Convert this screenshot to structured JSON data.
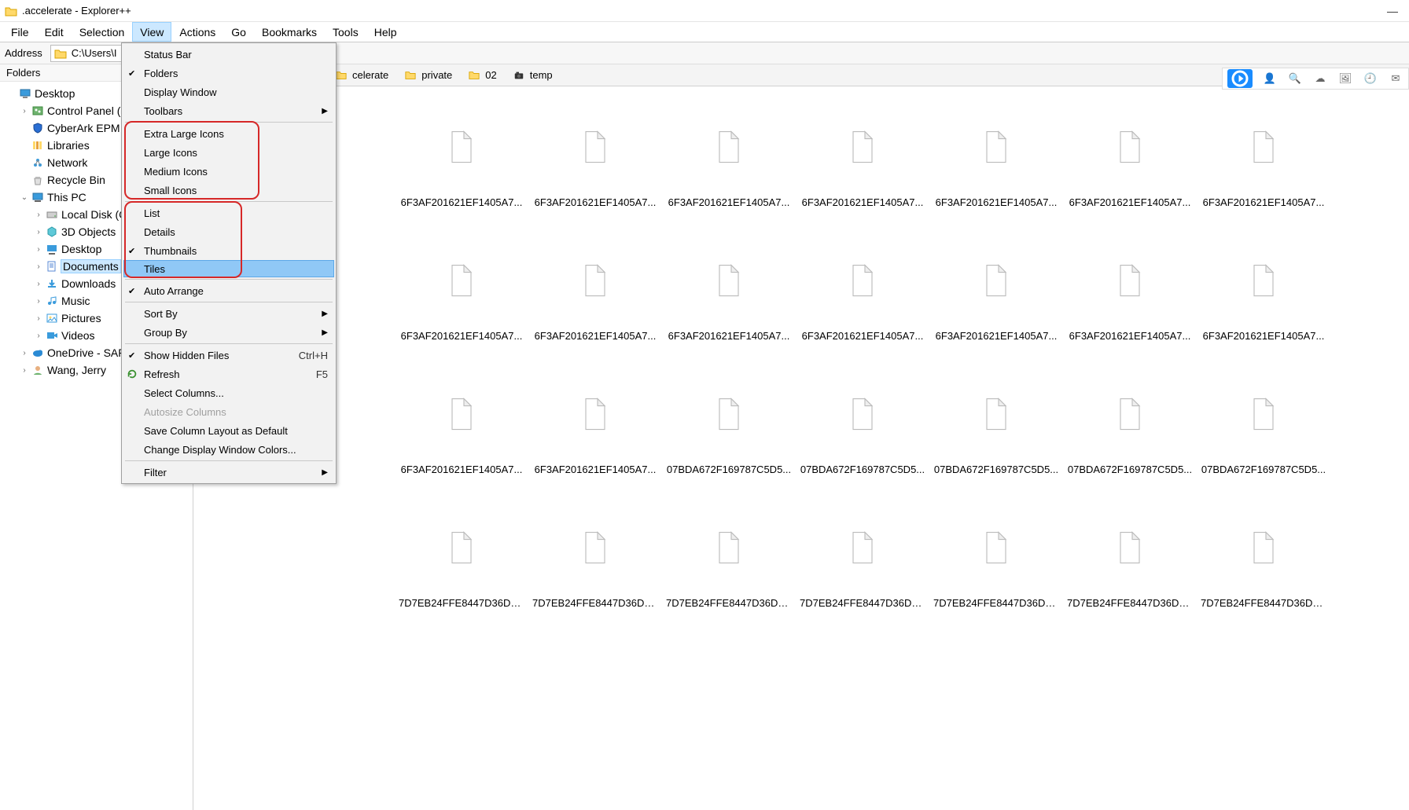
{
  "window": {
    "title": ".accelerate - Explorer++"
  },
  "menubar": {
    "items": [
      "File",
      "Edit",
      "Selection",
      "View",
      "Actions",
      "Go",
      "Bookmarks",
      "Tools",
      "Help"
    ],
    "active_index": 3
  },
  "addressbar": {
    "label": "Address",
    "path": "C:\\Users\\I"
  },
  "sidebar": {
    "header": "Folders",
    "tree": [
      {
        "label": "Desktop",
        "icon": "monitor",
        "indent": 0,
        "expandable": false
      },
      {
        "label": "Control Panel (",
        "icon": "panel",
        "indent": 1,
        "expandable": true
      },
      {
        "label": "CyberArk EPM C",
        "icon": "shield",
        "indent": 1,
        "expandable": false
      },
      {
        "label": "Libraries",
        "icon": "libraries",
        "indent": 1,
        "expandable": false
      },
      {
        "label": "Network",
        "icon": "network",
        "indent": 1,
        "expandable": false
      },
      {
        "label": "Recycle Bin",
        "icon": "recycle",
        "indent": 1,
        "expandable": false
      },
      {
        "label": "This PC",
        "icon": "pc",
        "indent": 1,
        "expandable": true,
        "expanded": true
      },
      {
        "label": "Local Disk (C",
        "icon": "disk",
        "indent": 2,
        "expandable": true
      },
      {
        "label": "3D Objects",
        "icon": "3d",
        "indent": 2,
        "expandable": true
      },
      {
        "label": "Desktop",
        "icon": "desktop",
        "indent": 2,
        "expandable": true
      },
      {
        "label": "Documents",
        "icon": "docs",
        "indent": 2,
        "expandable": true,
        "selected": true
      },
      {
        "label": "Downloads",
        "icon": "downloads",
        "indent": 2,
        "expandable": true
      },
      {
        "label": "Music",
        "icon": "music",
        "indent": 2,
        "expandable": true
      },
      {
        "label": "Pictures",
        "icon": "pictures",
        "indent": 2,
        "expandable": true
      },
      {
        "label": "Videos",
        "icon": "videos",
        "indent": 2,
        "expandable": true
      },
      {
        "label": "OneDrive - SAP",
        "icon": "onedrive",
        "indent": 1,
        "expandable": true
      },
      {
        "label": "Wang, Jerry",
        "icon": "user",
        "indent": 1,
        "expandable": true
      }
    ]
  },
  "tabs": [
    {
      "label": "celerate",
      "icon": "folder-partial"
    },
    {
      "label": "private",
      "icon": "folder"
    },
    {
      "label": "02",
      "icon": "folder"
    },
    {
      "label": "temp",
      "icon": "camera"
    }
  ],
  "rightbar_icons": [
    "play-blue",
    "person",
    "search",
    "cloud",
    "gallery",
    "clock",
    "mail"
  ],
  "view_menu": {
    "groups": [
      [
        {
          "label": "Status Bar"
        },
        {
          "label": "Folders",
          "checked": true
        },
        {
          "label": "Display Window"
        },
        {
          "label": "Toolbars",
          "submenu": true
        }
      ],
      [
        {
          "label": "Extra Large Icons"
        },
        {
          "label": "Large Icons"
        },
        {
          "label": "Medium Icons"
        },
        {
          "label": "Small Icons"
        }
      ],
      [
        {
          "label": "List"
        },
        {
          "label": "Details"
        },
        {
          "label": "Thumbnails",
          "checked": true
        },
        {
          "label": "Tiles",
          "highlighted": true
        }
      ],
      [
        {
          "label": "Auto Arrange",
          "checked": true
        }
      ],
      [
        {
          "label": "Sort By",
          "submenu": true
        },
        {
          "label": "Group By",
          "submenu": true
        }
      ],
      [
        {
          "label": "Show Hidden Files",
          "checked": true,
          "shortcut": "Ctrl+H"
        },
        {
          "label": "Refresh",
          "icon": "refresh",
          "shortcut": "F5"
        },
        {
          "label": "Select Columns..."
        },
        {
          "label": "Autosize Columns",
          "disabled": true
        },
        {
          "label": "Save Column Layout as Default"
        },
        {
          "label": "Change Display Window Colors..."
        }
      ],
      [
        {
          "label": "Filter",
          "submenu": true
        }
      ]
    ]
  },
  "files": [
    "6F3AF201621EF1405A7...",
    "6F3AF201621EF1405A7...",
    "6F3AF201621EF1405A7...",
    "6F3AF201621EF1405A7...",
    "6F3AF201621EF1405A7...",
    "6F3AF201621EF1405A7...",
    "6F3AF201621EF1405A7...",
    "6F3AF201621EF1405A7...",
    "6F3AF201621EF1405A7...",
    "6F3AF201621EF1405A7...",
    "6F3AF201621EF1405A7...",
    "6F3AF201621EF1405A7...",
    "6F3AF201621EF1405A7...",
    "6F3AF201621EF1405A7...",
    "6F3AF201621EF1405A7...",
    "6F3AF201621EF1405A7...",
    "07BDA672F169787C5D5...",
    "07BDA672F169787C5D5...",
    "07BDA672F169787C5D5...",
    "07BDA672F169787C5D5...",
    "07BDA672F169787C5D5...",
    "7D7EB24FFE8447D36DC...",
    "7D7EB24FFE8447D36DC...",
    "7D7EB24FFE8447D36DC...",
    "7D7EB24FFE8447D36DC...",
    "7D7EB24FFE8447D36DC...",
    "7D7EB24FFE8447D36DC...",
    "7D7EB24FFE8447D36DC..."
  ]
}
